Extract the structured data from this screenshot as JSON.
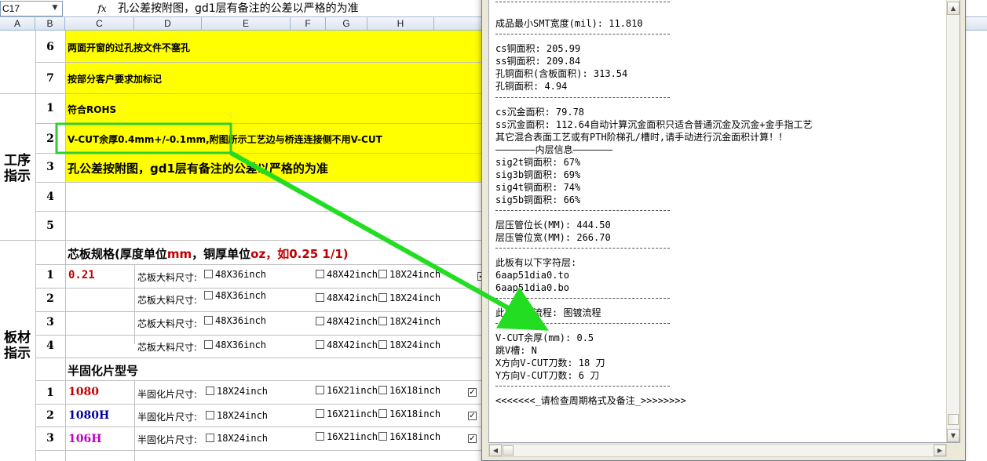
{
  "formula_bar": {
    "name_box": "C17",
    "fx_label": "fx",
    "content": "孔公差按附图，gd1层有备注的公差以严格的为准"
  },
  "columns": [
    "A",
    "B",
    "C",
    "D",
    "E",
    "F",
    "G",
    "H"
  ],
  "sheet": {
    "process_section": {
      "label_line1": "工序",
      "label_line2": "指示",
      "rows": [
        {
          "num": "6",
          "text": "两面开窗的过孔按文件不塞孔"
        },
        {
          "num": "7",
          "text": "按部分客户要求加标记"
        },
        {
          "num": "1",
          "text": "符合ROHS"
        },
        {
          "num": "2",
          "text": "V-CUT余厚0.4mm+/-0.1mm,附图所示工艺边与桥连连接侧不用V-CUT"
        },
        {
          "num": "3",
          "text": "孔公差按附图，gd1层有备注的公差以严格的为准"
        },
        {
          "num": "4",
          "text": ""
        },
        {
          "num": "5",
          "text": ""
        }
      ]
    },
    "board_section": {
      "label_line1": "板材",
      "label_line2": "指示",
      "core_header_prefix": "芯板规格(厚度单位",
      "core_header_unit1": "mm",
      "core_header_mid": "，铜厚单位",
      "core_header_unit2": "oz",
      "core_header_suffix": "，如0.25 1/1)",
      "core_rows": [
        {
          "num": "1",
          "value": "0.21",
          "label": "芯板大料尺寸:",
          "opt1": "48X36inch",
          "opt2": "48X42inch",
          "opt3": "18X24inch"
        },
        {
          "num": "2",
          "value": "",
          "label": "芯板大料尺寸:",
          "opt1": "48X36inch",
          "opt2": "48X42inch",
          "opt3": "18X24inch"
        },
        {
          "num": "3",
          "value": "",
          "label": "芯板大料尺寸:",
          "opt1": "48X36inch",
          "opt2": "48X42inch",
          "opt3": "18X24inch"
        },
        {
          "num": "4",
          "value": "",
          "label": "芯板大料尺寸:",
          "opt1": "48X36inch",
          "opt2": "48X42inch",
          "opt3": "18X24inch"
        }
      ],
      "prepreg_header": "半固化片型号",
      "prepreg_rows": [
        {
          "num": "1",
          "value": "1080",
          "label": "半固化片尺寸:",
          "opt1": "18X24inch",
          "opt2": "16X21inch",
          "opt3": "16X18inch"
        },
        {
          "num": "2",
          "value": "1080H",
          "label": "半固化片尺寸:",
          "opt1": "18X24inch",
          "opt2": "16X21inch",
          "opt3": "16X18inch"
        },
        {
          "num": "3",
          "value": "106H",
          "label": "半固化片尺寸:",
          "opt1": "18X24inch",
          "opt2": "16X21inch",
          "opt3": "16X18inch"
        }
      ]
    }
  },
  "notepad": {
    "lines": [
      "成品最小SMT宽度(mil): 11.810",
      "cs铜面积: 205.99",
      "ss铜面积: 209.84",
      "孔铜面积(含板面积): 313.54",
      "孔铜面积: 4.94",
      "cs沉金面积: 79.78",
      "ss沉金面积: 112.64自动计算沉金面积只适合普通沉金及沉金+金手指工艺",
      "其它混合表面工艺或有PTH阶梯孔/槽时,请手动进行沉金面积计算！！",
      "———————内层信息———————",
      "sig2t铜面积: 67%",
      "sig3b铜面积: 69%",
      "sig4t铜面积: 74%",
      "sig5b铜面积: 66%",
      "层压管位长(MM): 444.50",
      "层压管位宽(MM): 266.70",
      "此板有以下字符层:",
      "6aap51dia0.to",
      "6aap51dia0.bo",
      "此板工艺流程: 图镀流程",
      "V-CUT余厚(mm): 0.5",
      "跳V槽: N",
      "X方向V-CUT刀数: 18 刀",
      "Y方向V-CUT刀数: 6 刀",
      "<<<<<<<_请检查周期格式及备注_>>>>>>>>"
    ]
  },
  "colors": {
    "highlight_fill": "#ffff00",
    "annotation_box": "#33cc33",
    "annotation_arrow": "#22dd22"
  }
}
